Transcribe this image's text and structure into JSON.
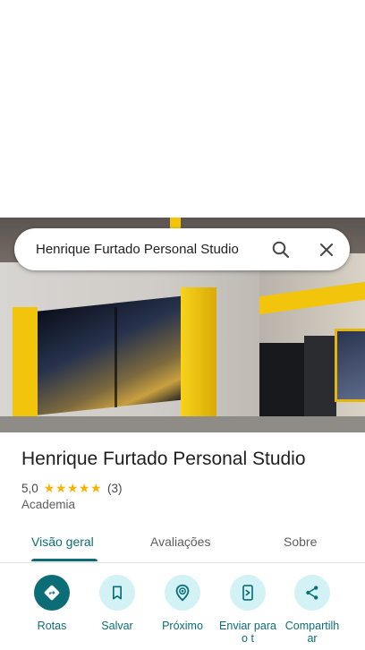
{
  "search": {
    "query": "Henrique Furtado Personal Studio"
  },
  "place": {
    "title": "Henrique Furtado Personal Studio",
    "rating": "5,0",
    "stars": "★★★★★",
    "review_count": "(3)",
    "category": "Academia"
  },
  "tabs": [
    {
      "label": "Visão geral",
      "active": true
    },
    {
      "label": "Avaliações",
      "active": false
    },
    {
      "label": "Sobre",
      "active": false
    }
  ],
  "actions": [
    {
      "label": "Rotas",
      "icon": "directions-icon"
    },
    {
      "label": "Salvar",
      "icon": "bookmark-icon"
    },
    {
      "label": "Próximo",
      "icon": "nearby-icon"
    },
    {
      "label": "Enviar para o t",
      "icon": "send-to-phone-icon"
    },
    {
      "label": "Compartilhar",
      "icon": "share-icon"
    }
  ],
  "colors": {
    "accent": "#0b6e77",
    "accent_light": "#d3f2f5",
    "star": "#f4b400",
    "brand_yellow": "#f2c40b"
  }
}
